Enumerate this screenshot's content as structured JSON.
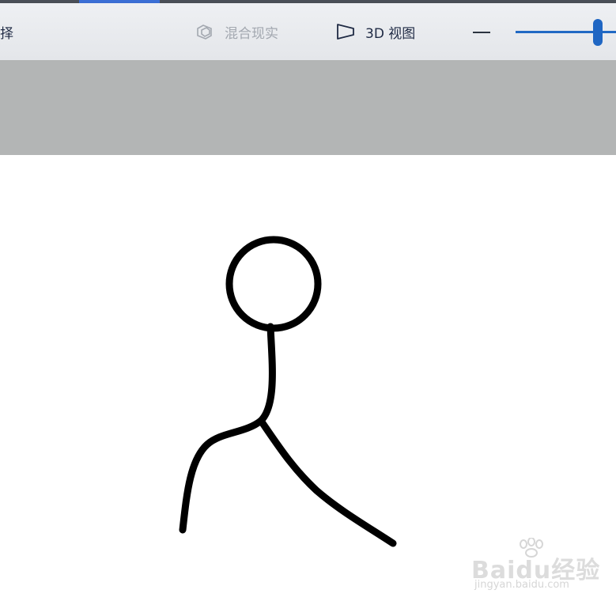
{
  "toolbar": {
    "select_label": "择",
    "mixed_reality_label": "混合现实",
    "view3d_label": "3D 视图",
    "mixed_reality_icon": "mixed-reality-icon",
    "view3d_icon": "3d-view-icon",
    "zoom_out_icon": "minus-icon",
    "zoom_level_fraction": 0.82,
    "accent_color": "#1f66c3"
  },
  "watermark": {
    "logo_text": "Baidu经验",
    "sub_text": "jingyan.baidu.com"
  },
  "canvas": {
    "background": "#ffffff",
    "stroke_color": "#000000"
  }
}
